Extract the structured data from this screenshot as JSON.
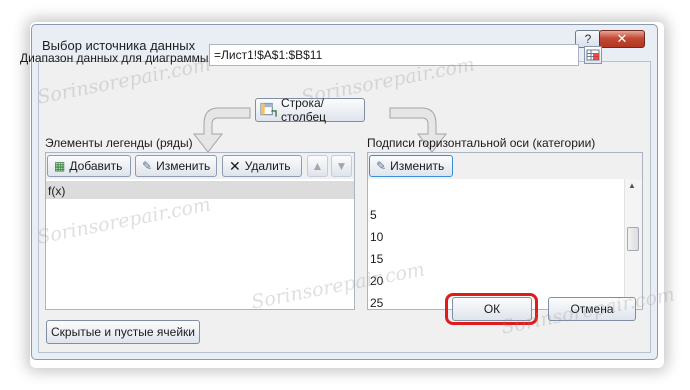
{
  "window": {
    "title": "Выбор источника данных",
    "help_label": "?",
    "close_label": "✕"
  },
  "data_range": {
    "label": "Диапазон данных для диаграммы:",
    "value": "=Лист1!$A$1:$B$11",
    "picker_icon": "range-selector-icon"
  },
  "switch_button": {
    "label": "Строка/столбец",
    "icon": "switch-row-column-icon"
  },
  "legend": {
    "title": "Элементы легенды (ряды)",
    "add_label": "Добавить",
    "edit_label": "Изменить",
    "delete_label": "Удалить",
    "items": [
      "f(x)"
    ]
  },
  "axis": {
    "title": "Подписи горизонтальной оси (категории)",
    "edit_label": "Изменить",
    "items": [
      "5",
      "10",
      "15",
      "20",
      "25"
    ]
  },
  "footer": {
    "hidden_cells_label": "Скрытые и пустые ячейки",
    "ok_label": "ОК",
    "cancel_label": "Отмена"
  },
  "watermark": "Sorinsorepair.com",
  "colors": {
    "highlight_ring": "#e01b1b",
    "dialog_bg": "#e9eef5",
    "close_button": "#c24a35"
  }
}
